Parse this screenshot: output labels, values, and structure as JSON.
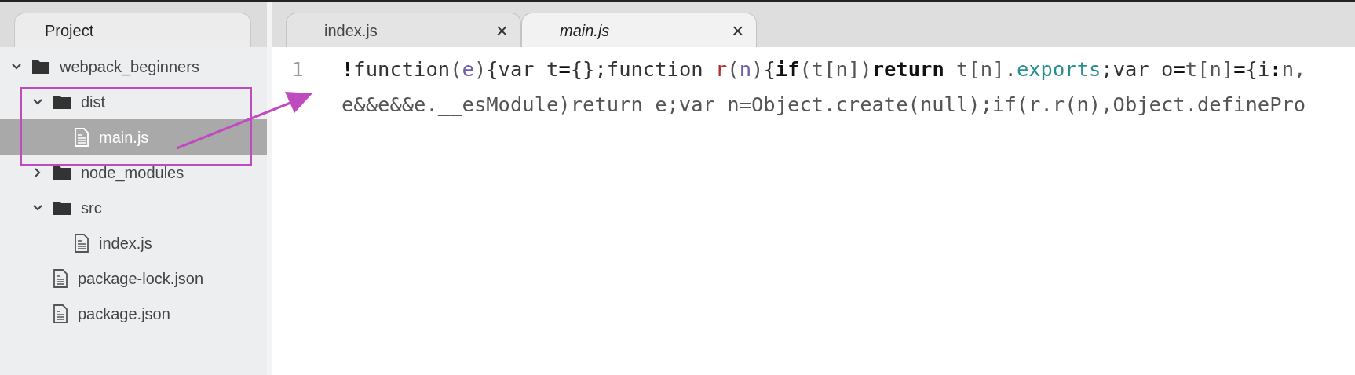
{
  "sidebar": {
    "tab": "Project",
    "tree": [
      {
        "name": "webpack_beginners",
        "kind": "folder",
        "expanded": true,
        "selected": false,
        "children": [
          {
            "name": "dist",
            "kind": "folder",
            "expanded": true,
            "selected": false,
            "children": [
              {
                "name": "main.js",
                "kind": "file",
                "selected": true
              }
            ]
          },
          {
            "name": "node_modules",
            "kind": "folder",
            "expanded": false,
            "selected": false
          },
          {
            "name": "src",
            "kind": "folder",
            "expanded": true,
            "selected": false,
            "children": [
              {
                "name": "index.js",
                "kind": "file",
                "selected": false
              }
            ]
          },
          {
            "name": "package-lock.json",
            "kind": "file",
            "selected": false
          },
          {
            "name": "package.json",
            "kind": "file",
            "selected": false
          }
        ]
      }
    ]
  },
  "tabs": [
    {
      "label": "index.js",
      "close": "×",
      "selected": false
    },
    {
      "label": "main.js",
      "close": "×",
      "selected": true
    }
  ],
  "editor": {
    "lines": [
      {
        "number": "1",
        "tokens": [
          {
            "kind": "bold",
            "text": "!"
          },
          {
            "kind": "plain",
            "text": "function"
          },
          {
            "kind": "punct",
            "text": "("
          },
          {
            "kind": "param",
            "text": "e"
          },
          {
            "kind": "punct",
            "text": ")"
          },
          {
            "kind": "plain",
            "text": "{var t"
          },
          {
            "kind": "bold",
            "text": "="
          },
          {
            "kind": "plain",
            "text": "{};function "
          },
          {
            "kind": "name",
            "text": "r"
          },
          {
            "kind": "punct",
            "text": "("
          },
          {
            "kind": "param",
            "text": "n"
          },
          {
            "kind": "punct",
            "text": ")"
          },
          {
            "kind": "plain",
            "text": "{"
          },
          {
            "kind": "bold",
            "text": "if"
          },
          {
            "kind": "punct",
            "text": "(t[n])"
          },
          {
            "kind": "bold",
            "text": "return"
          },
          {
            "kind": "punct",
            "text": " t[n]."
          },
          {
            "kind": "property",
            "text": "exports"
          },
          {
            "kind": "plain",
            "text": ";var o"
          },
          {
            "kind": "bold",
            "text": "="
          },
          {
            "kind": "punct",
            "text": "t[n]"
          },
          {
            "kind": "bold",
            "text": "="
          },
          {
            "kind": "plain",
            "text": "{i"
          },
          {
            "kind": "bold",
            "text": ":"
          },
          {
            "kind": "punct",
            "text": "n,"
          }
        ]
      },
      {
        "tokens": [
          {
            "kind": "punct",
            "text": "e&&e&&e.__esModule)return e;var n=Object.create(null);if(r.r(n),Object.definePro"
          }
        ]
      }
    ]
  }
}
